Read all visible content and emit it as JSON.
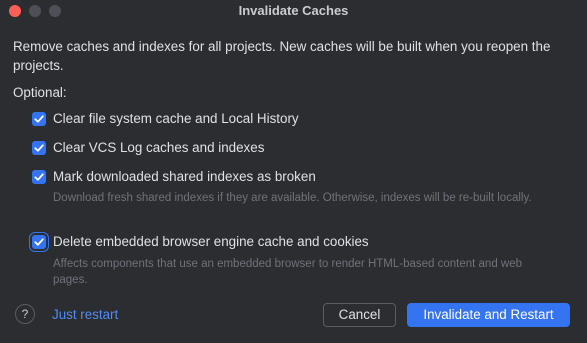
{
  "window": {
    "title": "Invalidate Caches"
  },
  "message": "Remove caches and indexes for all projects. New caches will be built when you reopen the projects.",
  "optional_label": "Optional:",
  "options": [
    {
      "label": "Clear file system cache and Local History",
      "checked": true,
      "hint": ""
    },
    {
      "label": "Clear VCS Log caches and indexes",
      "checked": true,
      "hint": ""
    },
    {
      "label": "Mark downloaded shared indexes as broken",
      "checked": true,
      "hint": "Download fresh shared indexes if they are available. Otherwise, indexes will be re-built locally."
    },
    {
      "label": "Delete embedded browser engine cache and cookies",
      "checked": true,
      "hint": "Affects components that use an embedded browser to render HTML-based content and web pages."
    }
  ],
  "footer": {
    "help_glyph": "?",
    "just_restart_label": "Just restart",
    "cancel_label": "Cancel",
    "primary_label": "Invalidate and Restart"
  },
  "colors": {
    "background": "#2b2d30",
    "accent": "#3574f0",
    "link": "#548af7",
    "hint_text": "#6f737a"
  }
}
